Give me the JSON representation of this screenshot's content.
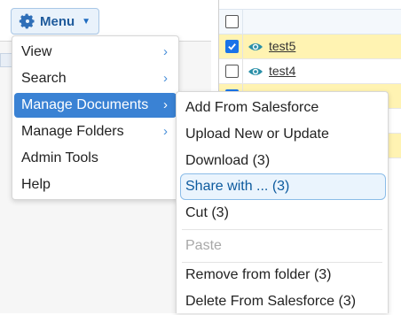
{
  "toolbar": {
    "menu_label": "Menu",
    "menu_icon": "gear-icon",
    "caret_icon": "caret-down-icon"
  },
  "grid": {
    "rows": [
      {
        "name": "test5",
        "checked": true,
        "selected": true
      },
      {
        "name": "test4",
        "checked": false,
        "selected": false
      },
      {
        "name": "",
        "checked": true,
        "selected": true
      },
      {
        "name": "",
        "checked": false,
        "selected": false
      },
      {
        "name": "",
        "checked": false,
        "selected": true
      }
    ]
  },
  "main_menu": {
    "items": [
      {
        "label": "View",
        "has_submenu": true
      },
      {
        "label": "Search",
        "has_submenu": true
      },
      {
        "label": "Manage Documents",
        "has_submenu": true,
        "active": true
      },
      {
        "label": "Manage Folders",
        "has_submenu": true
      },
      {
        "label": "Admin Tools",
        "has_submenu": false
      },
      {
        "label": "Help",
        "has_submenu": false
      }
    ]
  },
  "sub_menu": {
    "items": [
      {
        "label": "Add From Salesforce"
      },
      {
        "label": "Upload New or Update"
      },
      {
        "label": "Download (3)"
      },
      {
        "label": "Share with ... (3)",
        "hover": true
      },
      {
        "label": "Cut (3)"
      },
      {
        "label": "Paste",
        "disabled": true
      },
      {
        "label": "Remove from folder (3)"
      },
      {
        "label": "Delete From Salesforce (3)"
      }
    ]
  },
  "colors": {
    "accent": "#3a82d4",
    "row_highlight": "#fff3b2",
    "checkbox": "#1a73e8",
    "eye": "#2a8fa8"
  }
}
